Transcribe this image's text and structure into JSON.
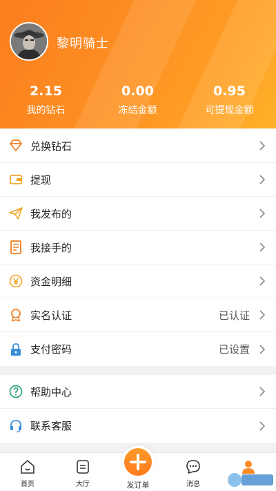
{
  "profile": {
    "username": "黎明骑士"
  },
  "stats": [
    {
      "value": "2.15",
      "label": "我的钻石"
    },
    {
      "value": "0.00",
      "label": "冻结金额"
    },
    {
      "value": "0.95",
      "label": "可提现金额"
    }
  ],
  "menu": {
    "exchange": {
      "label": "兑换钻石",
      "icon": "diamond-icon"
    },
    "withdraw": {
      "label": "提现",
      "icon": "wallet-icon"
    },
    "published": {
      "label": "我发布的",
      "icon": "send-icon"
    },
    "accepted": {
      "label": "我接手的",
      "icon": "document-icon"
    },
    "funds": {
      "label": "资金明细",
      "icon": "yen-icon"
    },
    "realname": {
      "label": "实名认证",
      "status": "已认证",
      "icon": "medal-icon"
    },
    "paypwd": {
      "label": "支付密码",
      "status": "已设置",
      "icon": "lock-icon"
    },
    "help": {
      "label": "帮助中心",
      "icon": "question-icon"
    },
    "service": {
      "label": "联系客服",
      "icon": "headset-icon"
    }
  },
  "tabs": [
    {
      "label": "首页",
      "icon": "home-icon"
    },
    {
      "label": "大厅",
      "icon": "hall-icon"
    },
    {
      "label": "发订单",
      "icon": "plus-icon"
    },
    {
      "label": "消息",
      "icon": "message-icon"
    },
    {
      "label": "",
      "icon": "profile-icon"
    }
  ],
  "colors": {
    "accent": "#fd8a22",
    "accent_dark": "#fb7a1d",
    "text": "#222222",
    "muted": "#555555"
  }
}
